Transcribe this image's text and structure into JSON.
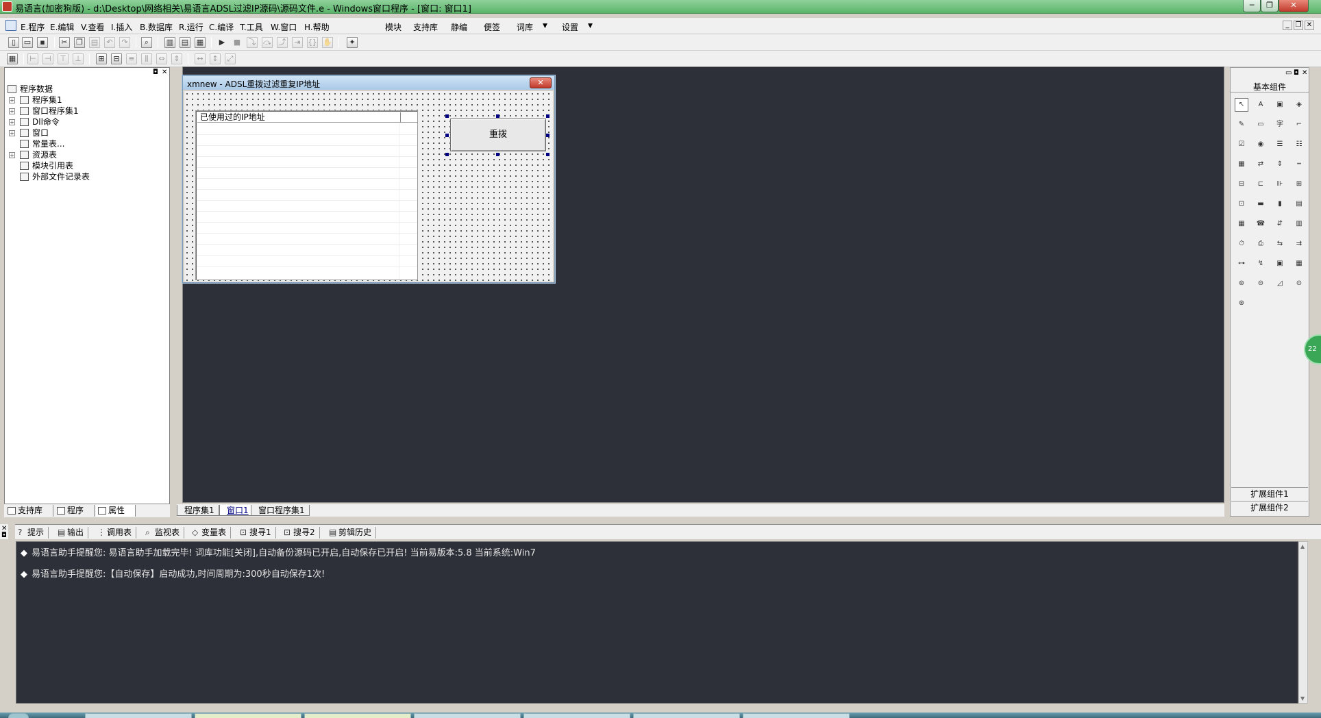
{
  "window": {
    "title": "易语言(加密狗版) - d:\\Desktop\\网络相关\\易语言ADSL过滤IP源码\\源码文件.e - Windows窗口程序 - [窗口: 窗口1]",
    "minimize_label": "─",
    "restore_label": "❐",
    "close_label": "✕"
  },
  "menu": {
    "items": [
      "E.程序",
      "E.编辑",
      "V.查看",
      "I.插入",
      "B.数据库",
      "R.运行",
      "C.编译",
      "T.工具",
      "W.窗口",
      "H.帮助"
    ],
    "extra": [
      "模块",
      "支持库",
      "静编",
      "便签",
      "词库",
      "设置"
    ],
    "dropdown_glyph": "▼"
  },
  "left_panel": {
    "tree": [
      {
        "label": "程序数据",
        "icon": "database-icon"
      },
      {
        "label": "程序集1",
        "icon": "module-icon"
      },
      {
        "label": "窗口程序集1",
        "icon": "module-icon"
      },
      {
        "label": "Dll命令",
        "icon": "dll-icon"
      },
      {
        "label": "窗口",
        "icon": "window-icon"
      },
      {
        "label": "常量表...",
        "icon": "constant-icon"
      },
      {
        "label": "资源表",
        "icon": "resource-icon"
      },
      {
        "label": "模块引用表",
        "icon": "module-ref-icon"
      },
      {
        "label": "外部文件记录表",
        "icon": "file-record-icon"
      }
    ],
    "expander_glyph": "+",
    "tabs": [
      "支持库",
      "程序",
      "属性"
    ]
  },
  "form": {
    "title": "xmnew - ADSL重拨过滤重复IP地址",
    "close_glyph": "✕",
    "list_header": "已使用过的IP地址",
    "button_label": "重拨"
  },
  "editor_tabs": [
    "程序集1",
    "窗口1",
    "窗口程序集1"
  ],
  "right_panel": {
    "title": "基本组件",
    "ext1": "扩展组件1",
    "ext2": "扩展组件2",
    "components": [
      "↖",
      "A",
      "▣",
      "◈",
      "✎",
      "▭",
      "字",
      "⌐",
      "☑",
      "◉",
      "☰",
      "☷",
      "▦",
      "⇄",
      "⇕",
      "┅",
      "⊟",
      "⊏",
      "⊪",
      "⊞",
      "⊡",
      "▬",
      "▮",
      "▤",
      "▦",
      "☎",
      "⇵",
      "▥",
      "⏱",
      "⎙",
      "⇆",
      "⇉",
      "⊶",
      "↯",
      "▣",
      "▦",
      "⊜",
      "⊝",
      "◿",
      "⊙",
      "⊛"
    ]
  },
  "bottom_tabs": [
    "提示",
    "输出",
    "调用表",
    "监视表",
    "变量表",
    "搜寻1",
    "搜寻2",
    "剪辑历史"
  ],
  "bottom_tab_icons": [
    "?",
    "▤",
    "⋮⋮",
    "⌕",
    "◇",
    "⊡",
    "⊡",
    "▤"
  ],
  "output_lines": [
    "易语言助手提醒您:  易语言助手加载完毕! 词库功能[关闭],自动备份源码已开启,自动保存已开启! 当前易版本:5.8  当前系统:Win7",
    "易语言助手提醒您:【自动保存】启动成功,时间周期为:300秒自动保存1次!"
  ],
  "bullet": "◆",
  "side_badge": "22"
}
